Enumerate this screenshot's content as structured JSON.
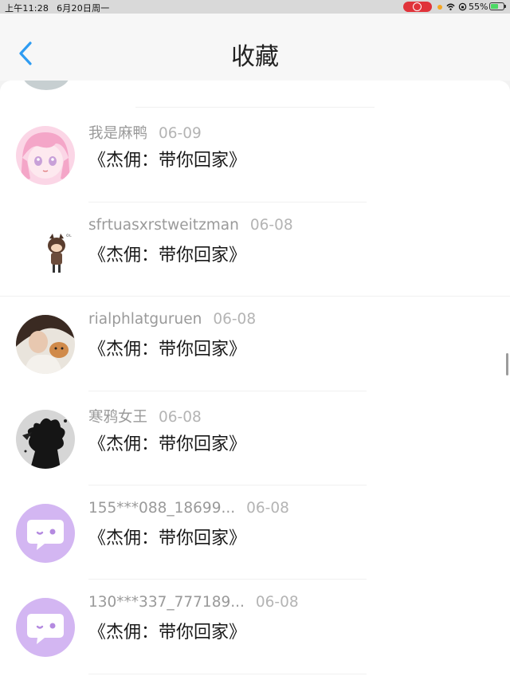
{
  "status_bar": {
    "time": "上午11:28",
    "date": "6月20日周一",
    "battery": "55%"
  },
  "header": {
    "title": "收藏"
  },
  "items": [
    {
      "name": "我是麻鸭",
      "date": "06-09",
      "title": "《杰佣：带你回家》",
      "avatar": "anime-girl-avatar"
    },
    {
      "name": "sfrtuasxrstweitzman",
      "date": "06-08",
      "title": "《杰佣：带你回家》",
      "avatar": "chibi-character-avatar"
    },
    {
      "name": "rialphlatguruen",
      "date": "06-08",
      "title": "《杰佣：带你回家》",
      "avatar": "photo-avatar"
    },
    {
      "name": "寒鸦女王",
      "date": "06-08",
      "title": "《杰佣：带你回家》",
      "avatar": "silhouette-avatar"
    },
    {
      "name": "155***088_18699...",
      "date": "06-08",
      "title": "《杰佣：带你回家》",
      "avatar": "default-chat-avatar"
    },
    {
      "name": "130***337_777189...",
      "date": "06-08",
      "title": "《杰佣：带你回家》",
      "avatar": "default-chat-avatar"
    }
  ],
  "colors": {
    "accent": "#2e9cf2",
    "default_avatar_bg": "#d3b6f2",
    "record_indicator": "#e0333a"
  }
}
